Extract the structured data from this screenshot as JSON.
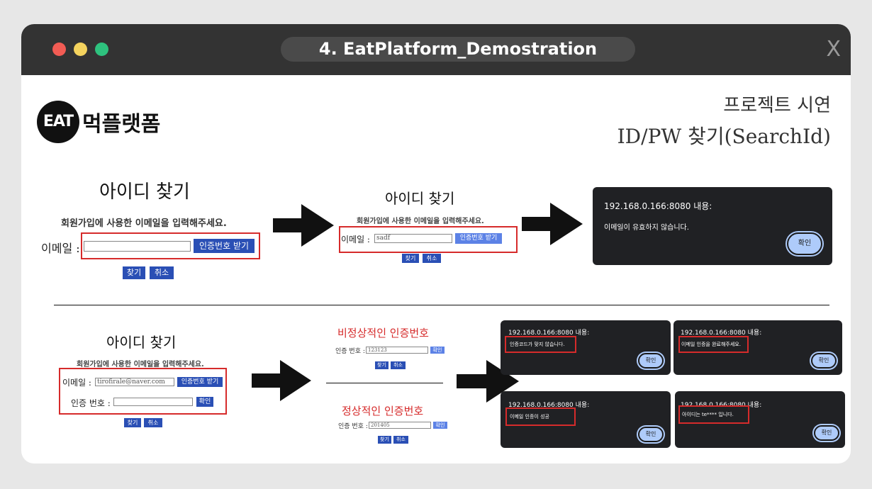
{
  "window": {
    "title": "4. EatPlatform_Demostration",
    "close_label": "X",
    "dots": {
      "red": "#f25c54",
      "yellow": "#f4d35e",
      "green": "#2ec27e"
    }
  },
  "logo": {
    "mark": "EAT",
    "name": "먹플랫폼"
  },
  "heading": {
    "line1": "프로젝트 시연",
    "line2": "ID/PW 찾기(SearchId)"
  },
  "step1": {
    "form": {
      "title": "아이디 찾기",
      "desc": "회원가입에 사용한 이메일을 입력해주세요.",
      "email_label": "이메일 :",
      "send_code_button": "인증번호 받기",
      "find_button": "찾기",
      "cancel_button": "취소"
    },
    "filled": {
      "title": "아이디 찾기",
      "desc": "회원가입에 사용한 이메일을 입력해주세요.",
      "email_label": "이메일 :",
      "email_value": "sadf",
      "send_code_button": "인증번호 받기",
      "find_button": "찾기",
      "cancel_button": "취소"
    },
    "alert": {
      "origin": "192.168.0.166:8080 내용:",
      "message": "이메일이 유효하지 않습니다.",
      "ok": "확인"
    }
  },
  "step2": {
    "form": {
      "title": "아이디 찾기",
      "desc": "회원가입에 사용한 이메일을 입력해주세요.",
      "email_label": "이메일 :",
      "email_value": "tirofirale@naver.com",
      "send_code_button": "인증번호 받기",
      "code_label": "인증 번호 :",
      "confirm_button": "확인",
      "find_button": "찾기",
      "cancel_button": "취소"
    },
    "invalid": {
      "title": "비정상적인 인증번호",
      "code_label": "인증 번호 :",
      "code_value": "123123",
      "confirm_button": "확인",
      "find_button": "찾기",
      "cancel_button": "취소"
    },
    "valid": {
      "title": "정상적인 인증번호",
      "code_label": "인증 번호 :",
      "code_value": "201405",
      "confirm_button": "확인",
      "find_button": "찾기",
      "cancel_button": "취소"
    },
    "alerts": [
      {
        "origin": "192.168.0.166:8080 내용:",
        "message": "인증코드가 맞지 않습니다.",
        "ok": "확인"
      },
      {
        "origin": "192.168.0.166:8080 내용:",
        "message": "이메일 인증을 완료해주세요.",
        "ok": "확인"
      },
      {
        "origin": "192.168.0.166:8080 내용:",
        "message": "이메일 인증이 성공",
        "ok": "확인"
      },
      {
        "origin": "192.168.0.166:8080 내용:",
        "message": "아이디는 te**** 입니다.",
        "ok": "확인"
      }
    ]
  },
  "colors": {
    "accent_button": "#2a4fb5",
    "highlight": "#d62b2b",
    "alert_bg": "#202124",
    "alert_ok": "#aecbfa"
  }
}
